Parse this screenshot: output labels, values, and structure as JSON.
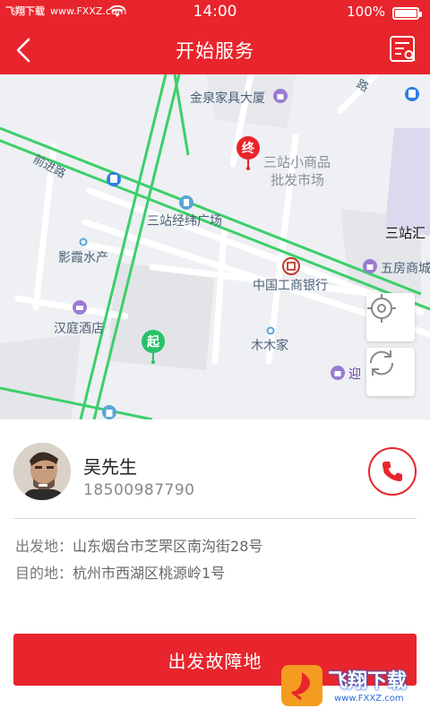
{
  "status_bar": {
    "carrier": "飞翔下载",
    "site": "www.FXXZ.com",
    "time": "14:00",
    "battery": "100%"
  },
  "header": {
    "title": "开始服务"
  },
  "map": {
    "roads": [
      "前进路",
      "路"
    ],
    "pois": {
      "jinquan": "金泉家具大厦",
      "sanzhan_market_1": "三站小商品",
      "sanzhan_market_2": "批发市场",
      "sanzhan_jingwei": "三站经纬广场",
      "sanzhan_hui": "三站汇",
      "wufang": "五房商城",
      "yingxia": "影霞水产",
      "icbc": "中国工商银行",
      "hanting": "汉庭酒店",
      "mumujia": "木木家",
      "ying": "迎"
    },
    "markers": {
      "end": "终",
      "start": "起"
    }
  },
  "customer": {
    "name": "吴先生",
    "phone": "18500987790"
  },
  "route": {
    "from_label": "出发地：",
    "from_value": "山东烟台市芝罘区南沟街28号",
    "to_label": "目的地：",
    "to_value": "杭州市西湖区桃源岭1号"
  },
  "action": {
    "button_label": "出发故障地"
  },
  "watermark": {
    "text": "飞翔下载",
    "url": "www.FXXZ.com"
  },
  "colors": {
    "brand": "#e8242c",
    "road_green": "#3ccf6a"
  }
}
